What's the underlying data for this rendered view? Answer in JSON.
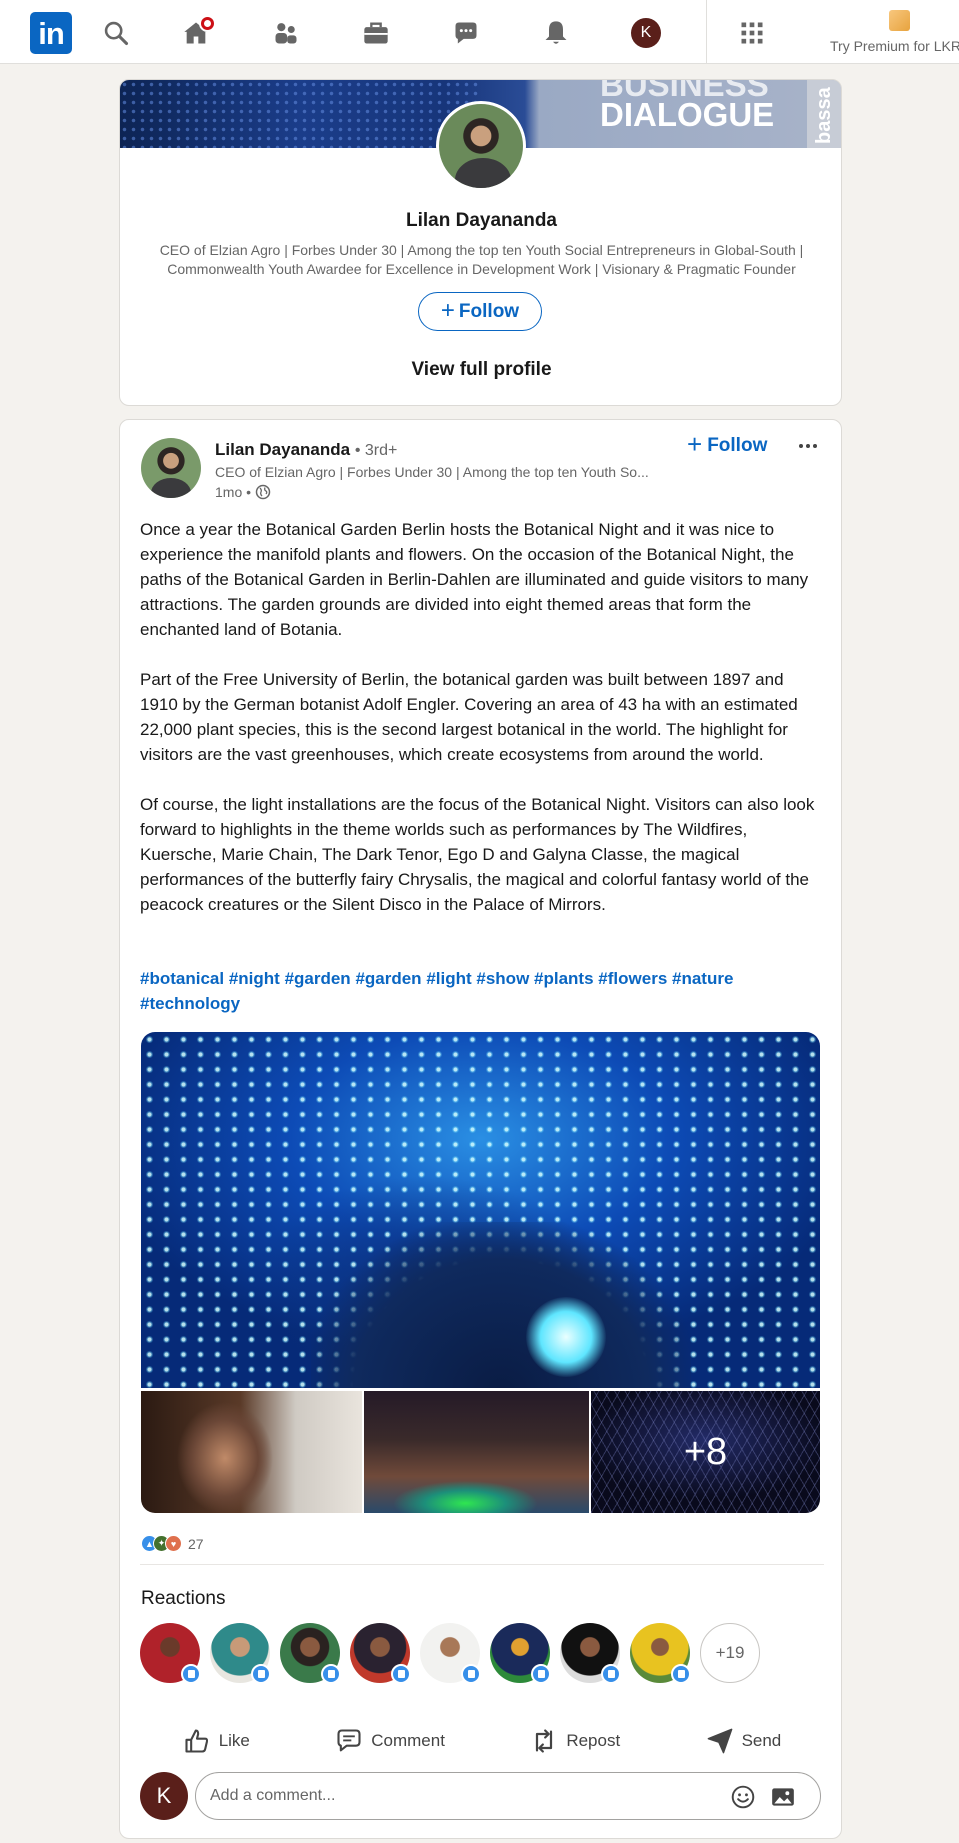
{
  "nav": {
    "logo_text": "in",
    "avatar_letter": "K",
    "premium_label": "Try Premium for LKR",
    "icons": [
      "search-icon",
      "home-icon",
      "my-network-icon",
      "jobs-icon",
      "messaging-icon",
      "notifications-icon",
      "work-grid-icon",
      "premium-icon"
    ]
  },
  "profile_card": {
    "banner_text_line1": "BUSINESS",
    "banner_text_line2": "DIALOGUE",
    "banner_side_text": "bassa",
    "name": "Lilan Dayananda",
    "headline": "CEO of Elzian Agro | Forbes Under 30 | Among the top ten Youth Social Entrepreneurs in Global-South | Commonwealth Youth Awardee for Excellence in Development Work | Visionary & Pragmatic Founder",
    "follow_label": "Follow",
    "view_profile_label": "View full profile"
  },
  "post": {
    "author_name": "Lilan Dayananda",
    "degree": "• 3rd+",
    "author_headline": "CEO of Elzian Agro | Forbes Under 30 | Among the top ten Youth So...",
    "time": "1mo •",
    "follow_label": "Follow",
    "paragraphs": [
      "Once a year the Botanical Garden Berlin hosts the Botanical Night and it was nice to experience the manifold plants and flowers. On the occasion of the Botanical Night, the paths of the Botanical Garden in Berlin-Dahlen are illuminated and guide visitors to many attractions. The garden grounds are divided into eight themed areas that form the enchanted land of Botania.",
      "Part of the Free University of Berlin, the botanical garden was built between 1897 and 1910 by the German botanist Adolf Engler. Covering an area of 43 ha with an estimated 22,000 plant species, this is the second largest botanical in the world. The highlight for visitors are the vast greenhouses, which create ecosystems from around the world.",
      "Of course, the light installations are the focus of the Botanical Night. Visitors can also look forward to highlights in the theme worlds such as performances by The Wildfires, Kuersche, Marie Chain, The Dark Tenor, Ego D and Galyna Classe, the magical performances of the butterfly fairy Chrysalis, the magical and colorful fantasy world of the peacock creatures or the Silent Disco in the Palace of Mirrors."
    ],
    "hashtags": [
      "#botanical",
      "#night",
      "#garden",
      "#garden",
      "#light",
      "#show",
      "#plants",
      "#flowers",
      "#nature",
      "#technology"
    ],
    "more_images_label": "+8",
    "reaction_count": "27",
    "reactions_title": "Reactions",
    "more_reactors_label": "+19",
    "actions": {
      "like": "Like",
      "comment": "Comment",
      "repost": "Repost",
      "send": "Send"
    },
    "comment_avatar_letter": "K",
    "comment_placeholder": "Add a comment..."
  }
}
